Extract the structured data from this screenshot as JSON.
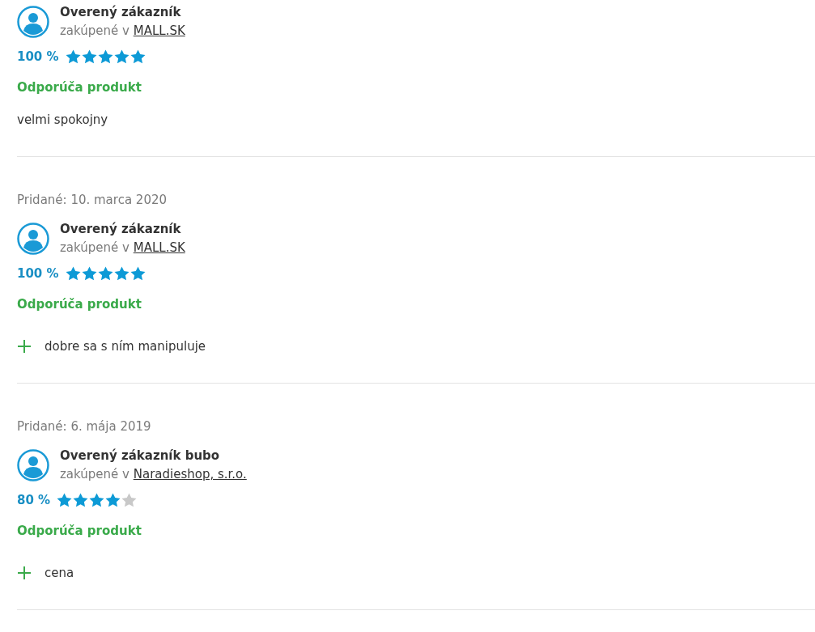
{
  "reviews": [
    {
      "author": "Overený zákazník",
      "purchased_prefix": "zakúpené v",
      "store": "MALL.SK",
      "percent": "100 %",
      "stars": 5,
      "recommendation": "Odporúča produkt",
      "comment": "velmi spokojny"
    },
    {
      "date": "Pridané: 10. marca 2020",
      "author": "Overený zákazník",
      "purchased_prefix": "zakúpené v",
      "store": "MALL.SK",
      "percent": "100 %",
      "stars": 5,
      "recommendation": "Odporúča produkt",
      "pros": [
        "dobre sa s ním manipuluje"
      ]
    },
    {
      "date": "Pridané: 6. mája 2019",
      "author": "Overený zákazník bubo",
      "purchased_prefix": "zakúpené v",
      "store": "Naradieshop, s.r.o.",
      "percent": "80 %",
      "stars": 4,
      "recommendation": "Odporúča produkt",
      "pros": [
        "cena"
      ]
    }
  ]
}
